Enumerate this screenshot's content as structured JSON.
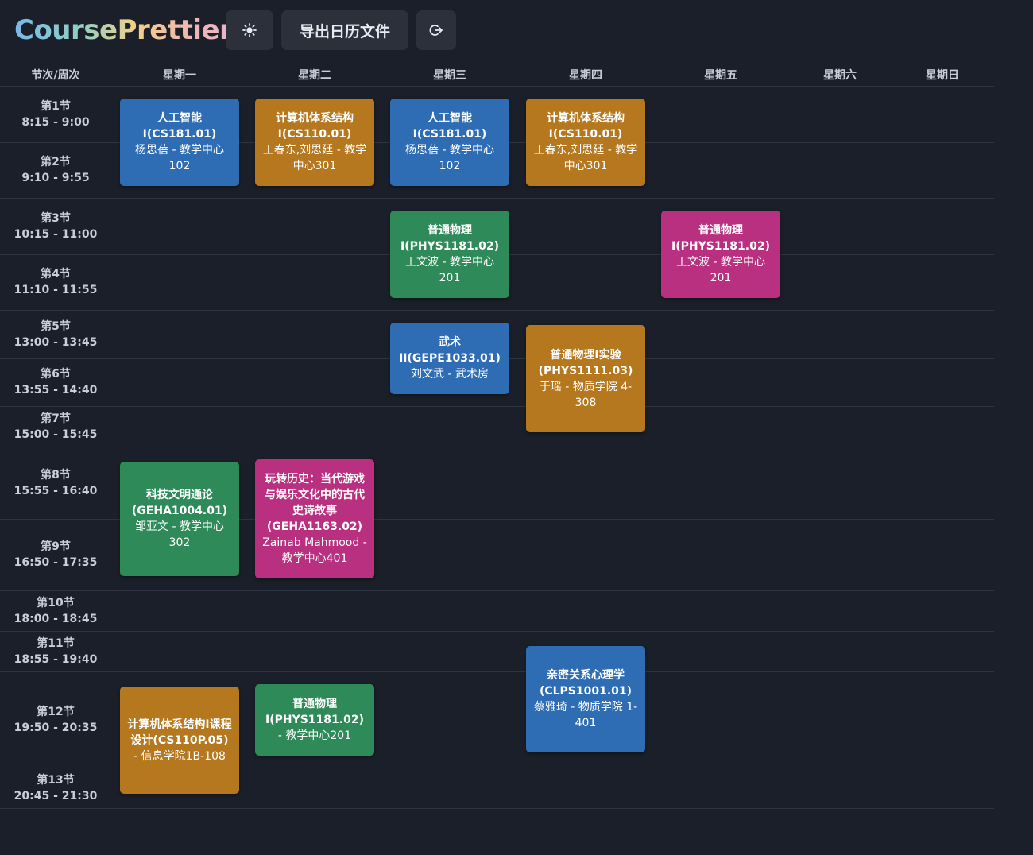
{
  "app": {
    "title": "CoursePrettier"
  },
  "toolbar": {
    "theme_icon": "sun-icon",
    "export_label": "导出日历文件",
    "logout_icon": "logout-icon"
  },
  "header": {
    "slot_col": "节次/周次",
    "days": [
      "星期一",
      "星期二",
      "星期三",
      "星期四",
      "星期五",
      "星期六",
      "星期日"
    ]
  },
  "slots": [
    {
      "name": "第1节",
      "time": "8:15 - 9:00"
    },
    {
      "name": "第2节",
      "time": "9:10 - 9:55"
    },
    {
      "name": "第3节",
      "time": "10:15 - 11:00"
    },
    {
      "name": "第4节",
      "time": "11:10 - 11:55"
    },
    {
      "name": "第5节",
      "time": "13:00 - 13:45"
    },
    {
      "name": "第6节",
      "time": "13:55 - 14:40"
    },
    {
      "name": "第7节",
      "time": "15:00 - 15:45"
    },
    {
      "name": "第8节",
      "time": "15:55 - 16:40"
    },
    {
      "name": "第9节",
      "time": "16:50 - 17:35"
    },
    {
      "name": "第10节",
      "time": "18:00 - 18:45"
    },
    {
      "name": "第11节",
      "time": "18:55 - 19:40"
    },
    {
      "name": "第12节",
      "time": "19:50 - 20:35"
    },
    {
      "name": "第13节",
      "time": "20:45 - 21:30"
    }
  ],
  "courses": [
    {
      "name": "人工智能I(CS181.01)",
      "info": "杨思蓓 - 教学中心102",
      "color": "#2e6db3",
      "day": "星期一",
      "slots": "1-2"
    },
    {
      "name": "计算机体系结构I(CS110.01)",
      "info": "王春东,刘思廷 - 教学中心301",
      "color": "#b5781f",
      "day": "星期二",
      "slots": "1-2"
    },
    {
      "name": "人工智能I(CS181.01)",
      "info": "杨思蓓 - 教学中心102",
      "color": "#2e6db3",
      "day": "星期三",
      "slots": "1-2"
    },
    {
      "name": "计算机体系结构I(CS110.01)",
      "info": "王春东,刘思廷 - 教学中心301",
      "color": "#b5781f",
      "day": "星期四",
      "slots": "1-2"
    },
    {
      "name": "普通物理I(PHYS1181.02)",
      "info": "王文波 - 教学中心201",
      "color": "#2e8a58",
      "day": "星期三",
      "slots": "3-4"
    },
    {
      "name": "普通物理I(PHYS1181.02)",
      "info": "王文波 - 教学中心201",
      "color": "#b8307f",
      "day": "星期五",
      "slots": "3-4"
    },
    {
      "name": "武术II(GEPE1033.01)",
      "info": "刘文武 - 武术房",
      "color": "#2e6db3",
      "day": "星期三",
      "slots": "5-6"
    },
    {
      "name": "普通物理I实验(PHYS1111.03)",
      "info": "于瑶 - 物质学院 4-308",
      "color": "#b5781f",
      "day": "星期四",
      "slots": "5-7"
    },
    {
      "name": "科技文明通论(GEHA1004.01)",
      "info": "邹亚文 - 教学中心302",
      "color": "#2e8a58",
      "day": "星期一",
      "slots": "8-9"
    },
    {
      "name": "玩转历史：当代游戏与娱乐文化中的古代史诗故事(GEHA1163.02)",
      "info": "Zainab Mahmood - 教学中心401",
      "color": "#b8307f",
      "day": "星期二",
      "slots": "8-9"
    },
    {
      "name": "亲密关系心理学(CLPS1001.01)",
      "info": "蔡雅琦 - 物质学院 1-401",
      "color": "#2e6db3",
      "day": "星期四",
      "slots": "11-12"
    },
    {
      "name": "计算机体系结构I课程设计(CS110P.05)",
      "info": " - 信息学院1B-108",
      "color": "#b5781f",
      "day": "星期一",
      "slots": "12-13"
    },
    {
      "name": "普通物理I(PHYS1181.02)",
      "info": " - 教学中心201",
      "color": "#2e8a58",
      "day": "星期二",
      "slots": "12"
    }
  ]
}
